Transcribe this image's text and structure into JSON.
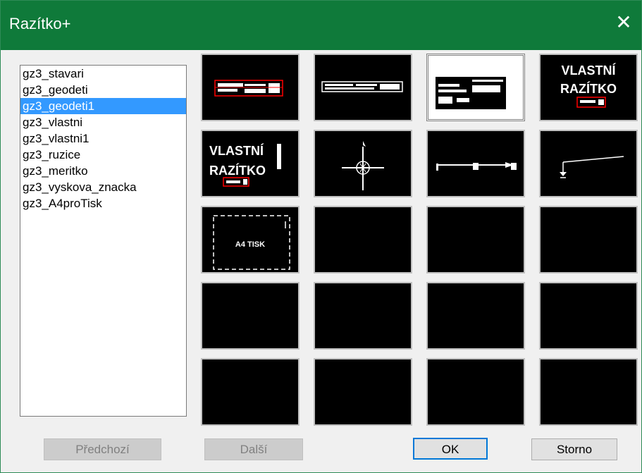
{
  "window": {
    "title": "Razítko+",
    "close_glyph": "✕"
  },
  "blocks": [
    "gz3_stavari",
    "gz3_geodeti",
    "gz3_geodeti1",
    "gz3_vlastni",
    "gz3_vlastni1",
    "gz3_ruzice",
    "gz3_meritko",
    "gz3_vyskova_znacka",
    "gz3_A4proTisk"
  ],
  "selected_index": 2,
  "previews": {
    "vlastni_line1": "VLASTNÍ",
    "vlastni_line2": "RAZÍTKO",
    "a4_label": "A4 TISK"
  },
  "buttons": {
    "prev": "Předchozí",
    "next": "Další",
    "ok": "OK",
    "cancel": "Storno"
  },
  "colors": {
    "titlebar": "#0f7a3a",
    "selection": "#3399ff",
    "accent_red": "#ff0000"
  }
}
